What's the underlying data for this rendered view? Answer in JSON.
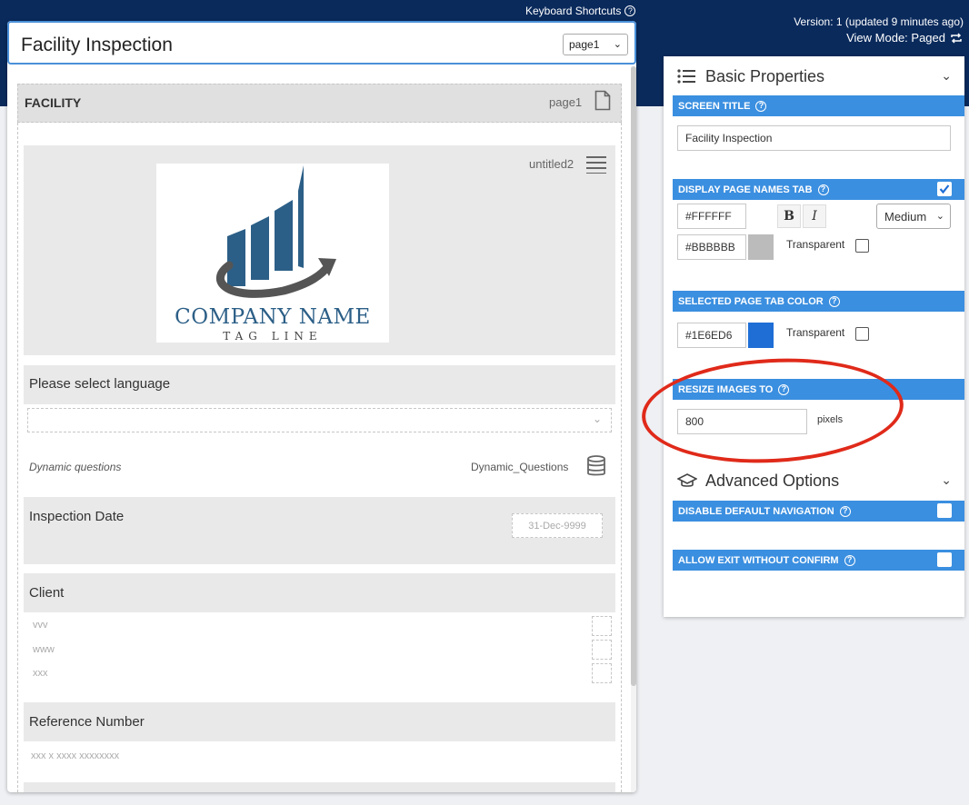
{
  "header": {
    "keyboard_shortcuts": "Keyboard Shortcuts",
    "version": "Version: 1 (updated 9 minutes ago)",
    "view_mode": "View Mode: Paged"
  },
  "form": {
    "title": "Facility Inspection",
    "page_select": "page1",
    "section_label": "FACILITY",
    "section_page": "page1",
    "image_block_name": "untitled2",
    "logo": {
      "company": "COMPANY NAME",
      "tagline": "TAG LINE"
    },
    "questions": {
      "language_label": "Please select language",
      "dynamic_label": "Dynamic questions",
      "dynamic_name": "Dynamic_Questions",
      "inspection_date_label": "Inspection Date",
      "inspection_date_placeholder": "31-Dec-9999",
      "client_label": "Client",
      "client_options": [
        "vvv",
        "www",
        "xxx"
      ],
      "reference_label": "Reference Number",
      "reference_hint": "xxx x xxxx xxxxxxxx"
    }
  },
  "panel": {
    "basic_properties": "Basic Properties",
    "screen_title_label": "SCREEN TITLE",
    "screen_title_value": "Facility Inspection",
    "display_page_names_label": "DISPLAY PAGE NAMES TAB",
    "display_page_names_checked": true,
    "text_color": "#FFFFFF",
    "bold": "B",
    "italic": "I",
    "size": "Medium",
    "bg_color": "#BBBBBB",
    "transparent_label": "Transparent",
    "selected_tab_color_label": "SELECTED PAGE TAB COLOR",
    "selected_tab_color": "#1E6ED6",
    "transparent_label_2": "Transparent",
    "resize_images_label": "RESIZE IMAGES TO",
    "resize_value": "800",
    "pixels_label": "pixels",
    "advanced_options": "Advanced Options",
    "disable_nav_label": "DISABLE DEFAULT NAVIGATION",
    "allow_exit_label": "ALLOW EXIT WITHOUT CONFIRM"
  },
  "colors": {
    "topbar": "#0A2A5C",
    "accent": "#3B8FE0",
    "swatch_grey": "#BBBBBB",
    "swatch_blue": "#1E6ED6",
    "annotation": "#E02A1A"
  }
}
